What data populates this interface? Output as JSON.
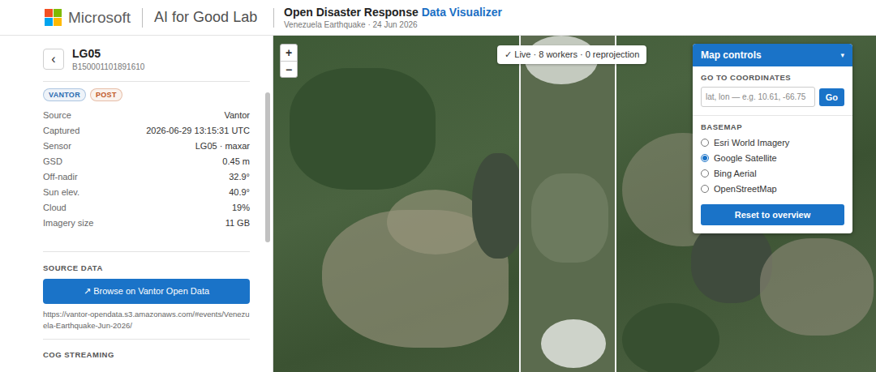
{
  "header": {
    "brand": "Microsoft",
    "lab": "AI for Good Lab",
    "title": "Open Disaster Response",
    "title_accent": "Data Visualizer",
    "subtitle": "Venezuela Earthquake · 24 Jun 2026"
  },
  "item": {
    "back": "‹",
    "title": "LG05",
    "id": "B150001101891610",
    "badges": [
      {
        "label": "VANTOR",
        "color": "#2b6cb0"
      },
      {
        "label": "POST",
        "color": "#c0561f"
      }
    ],
    "properties": [
      {
        "label": "Source",
        "value": "Vantor"
      },
      {
        "label": "Captured",
        "value": "2026-06-29 13:15:31 UTC"
      },
      {
        "label": "Sensor",
        "value": "LG05 · maxar"
      },
      {
        "label": "GSD",
        "value": "0.45 m"
      },
      {
        "label": "Off-nadir",
        "value": "32.9°"
      },
      {
        "label": "Sun elev.",
        "value": "40.9°"
      },
      {
        "label": "Cloud",
        "value": "19%"
      },
      {
        "label": "Imagery size",
        "value": "11 GB"
      }
    ]
  },
  "source_data": {
    "heading": "SOURCE DATA",
    "button": "↗ Browse on Vantor Open Data",
    "url": "https://vantor-opendata.s3.amazonaws.com/#events/Venezuela-Earthquake-Jun-2026/"
  },
  "cog_streaming": {
    "heading": "COG STREAMING"
  },
  "map": {
    "zoom_in": "+",
    "zoom_out": "−",
    "status": "✓ Live · 8 workers · 0 reprojection"
  },
  "map_controls": {
    "title": "Map controls",
    "toggle": "▾",
    "goto_label": "GO TO COORDINATES",
    "goto_placeholder": "lat, lon — e.g. 10.61, -66.75",
    "go": "Go",
    "basemap_label": "BASEMAP",
    "basemaps": [
      {
        "label": "Esri World Imagery",
        "selected": false
      },
      {
        "label": "Google Satellite",
        "selected": true
      },
      {
        "label": "Bing Aerial",
        "selected": false
      },
      {
        "label": "OpenStreetMap",
        "selected": false
      }
    ],
    "reset": "Reset to overview"
  }
}
